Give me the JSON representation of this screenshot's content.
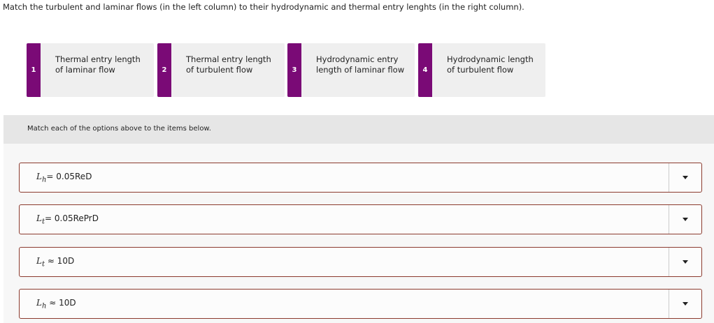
{
  "title": "Match the turbulent and laminar flows (in the left column) to their hydrodynamic and thermal entry lenghts (in the right column).",
  "options": [
    {
      "num": "1",
      "label": "Thermal entry length of laminar flow"
    },
    {
      "num": "2",
      "label": "Thermal entry length of turbulent flow"
    },
    {
      "num": "3",
      "label": "Hydrodynamic entry length of laminar flow"
    },
    {
      "num": "4",
      "label": "Hydrodynamic length of turbulent flow"
    }
  ],
  "instruction": "Match each of the options above to the items below.",
  "items": [
    {
      "var": "L",
      "sub": "h",
      "expr": "= 0.05ReD"
    },
    {
      "var": "L",
      "sub": "t",
      "expr": "= 0.05RePrD"
    },
    {
      "var": "L",
      "sub": "t",
      "expr": " ≈ 10D"
    },
    {
      "var": "L",
      "sub": "h",
      "expr": " ≈ 10D"
    }
  ],
  "colors": {
    "accent": "#7a0a76",
    "border": "#8b3a2e"
  }
}
